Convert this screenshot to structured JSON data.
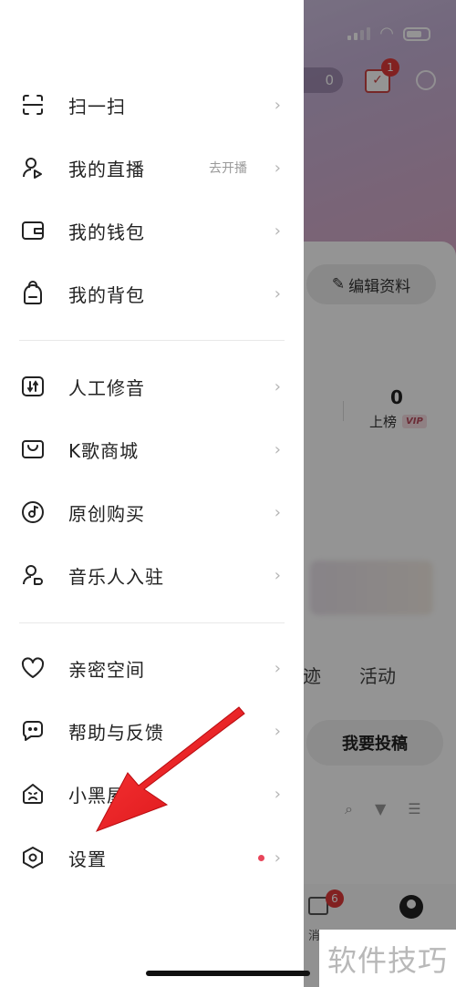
{
  "background": {
    "coin_count": "0",
    "calendar_badge": "1",
    "edit_profile_label": "编辑资料",
    "stat_value": "0",
    "stat_label": "上榜",
    "vip_label": "VIP",
    "tab_partial": "迹",
    "tab_activity": "活动",
    "submit_label": "我要投稿",
    "nav_msg_badge": "6",
    "nav_msg_label": "消"
  },
  "drawer": {
    "group1": [
      {
        "label": "扫一扫",
        "icon": "scan-icon"
      },
      {
        "label": "我的直播",
        "icon": "live-icon",
        "hint": "去开播"
      },
      {
        "label": "我的钱包",
        "icon": "wallet-icon"
      },
      {
        "label": "我的背包",
        "icon": "backpack-icon"
      }
    ],
    "group2": [
      {
        "label": "人工修音",
        "icon": "tuning-icon"
      },
      {
        "label": "K歌商城",
        "icon": "shop-icon"
      },
      {
        "label": "原创购买",
        "icon": "disc-icon"
      },
      {
        "label": "音乐人入驻",
        "icon": "musician-icon"
      }
    ],
    "group3": [
      {
        "label": "亲密空间",
        "icon": "heart-icon"
      },
      {
        "label": "帮助与反馈",
        "icon": "help-chat-icon"
      },
      {
        "label": "小黑屋",
        "icon": "house-icon"
      },
      {
        "label": "设置",
        "icon": "settings-icon"
      }
    ],
    "chevron": "›"
  },
  "watermark": "软件技巧",
  "colors": {
    "badge_red": "#e03a3a",
    "settings_dot": "#e8455a",
    "annotation_arrow": "#e8141a"
  }
}
